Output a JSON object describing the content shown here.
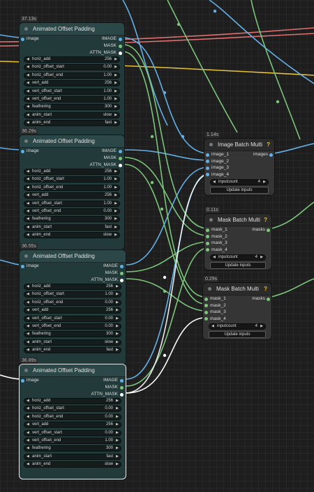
{
  "colors": {
    "canvas": "#1e1e1e",
    "wire_image": "#63b0e6",
    "wire_mask": "#7bc67b",
    "wire_attn_mask": "#ffffff",
    "wire_red": "#e07070",
    "wire_yellow": "#e8c23a",
    "node_body": "#233a3a",
    "help_icon": "#f2c300"
  },
  "offset_nodes": [
    {
      "time": "37.13s",
      "title": "Animated Offset Padding",
      "selected": false,
      "input": "image",
      "outputs": [
        "IMAGE",
        "MASK",
        "ATTN_MASK"
      ],
      "widgets": [
        {
          "label": "horiz_add",
          "value": "256",
          "kind": "number"
        },
        {
          "label": "horiz_offset_start",
          "value": "0.00",
          "kind": "number"
        },
        {
          "label": "horiz_offset_end",
          "value": "1.00",
          "kind": "number"
        },
        {
          "label": "vert_add",
          "value": "256",
          "kind": "number"
        },
        {
          "label": "vert_offset_start",
          "value": "1.00",
          "kind": "number"
        },
        {
          "label": "vert_offset_end",
          "value": "1.00",
          "kind": "number"
        },
        {
          "label": "feathering",
          "value": "300",
          "kind": "number"
        },
        {
          "label": "anim_start",
          "value": "slow",
          "kind": "combo"
        },
        {
          "label": "anim_end",
          "value": "fast",
          "kind": "combo"
        }
      ]
    },
    {
      "time": "36.29s",
      "title": "Animated Offset Padding",
      "selected": false,
      "input": "image",
      "outputs": [
        "IMAGE",
        "MASK",
        "ATTN_MASK"
      ],
      "widgets": [
        {
          "label": "horiz_add",
          "value": "256",
          "kind": "number"
        },
        {
          "label": "horiz_offset_start",
          "value": "1.00",
          "kind": "number"
        },
        {
          "label": "horiz_offset_end",
          "value": "1.00",
          "kind": "number"
        },
        {
          "label": "vert_add",
          "value": "256",
          "kind": "number"
        },
        {
          "label": "vert_offset_start",
          "value": "1.00",
          "kind": "number"
        },
        {
          "label": "vert_offset_end",
          "value": "0.00",
          "kind": "number"
        },
        {
          "label": "feathering",
          "value": "300",
          "kind": "number"
        },
        {
          "label": "anim_start",
          "value": "fast",
          "kind": "combo"
        },
        {
          "label": "anim_end",
          "value": "slow",
          "kind": "combo"
        }
      ]
    },
    {
      "time": "36.55s",
      "title": "Animated Offset Padding",
      "selected": false,
      "input": "image",
      "outputs": [
        "IMAGE",
        "MASK",
        "ATTN_MASK"
      ],
      "widgets": [
        {
          "label": "horiz_add",
          "value": "256",
          "kind": "number"
        },
        {
          "label": "horiz_offset_start",
          "value": "1.00",
          "kind": "number"
        },
        {
          "label": "horiz_offset_end",
          "value": "0.00",
          "kind": "number"
        },
        {
          "label": "vert_add",
          "value": "256",
          "kind": "number"
        },
        {
          "label": "vert_offset_start",
          "value": "0.00",
          "kind": "number"
        },
        {
          "label": "vert_offset_end",
          "value": "0.00",
          "kind": "number"
        },
        {
          "label": "feathering",
          "value": "300",
          "kind": "number"
        },
        {
          "label": "anim_start",
          "value": "slow",
          "kind": "combo"
        },
        {
          "label": "anim_end",
          "value": "fast",
          "kind": "combo"
        }
      ]
    },
    {
      "time": "36.89s",
      "title": "Animated Offset Padding",
      "selected": true,
      "input": "image",
      "outputs": [
        "IMAGE",
        "MASK",
        "ATTN_MASK"
      ],
      "widgets": [
        {
          "label": "horiz_add",
          "value": "256",
          "kind": "number"
        },
        {
          "label": "horiz_offset_start",
          "value": "0.00",
          "kind": "number"
        },
        {
          "label": "horiz_offset_end",
          "value": "0.00",
          "kind": "number"
        },
        {
          "label": "vert_add",
          "value": "256",
          "kind": "number"
        },
        {
          "label": "vert_offset_start",
          "value": "0.00",
          "kind": "number"
        },
        {
          "label": "vert_offset_end",
          "value": "1.00",
          "kind": "number"
        },
        {
          "label": "feathering",
          "value": "300",
          "kind": "number"
        },
        {
          "label": "anim_start",
          "value": "fast",
          "kind": "combo"
        },
        {
          "label": "anim_end",
          "value": "slow",
          "kind": "combo"
        }
      ]
    }
  ],
  "batch_nodes": [
    {
      "time": "1.14s",
      "title": "Image Batch Multi",
      "help": "?",
      "inputs": [
        "image_1",
        "image_2",
        "image_3",
        "image_4"
      ],
      "output": "images",
      "inputcount_label": "inputcount",
      "inputcount_value": "4",
      "button": "Update inputs"
    },
    {
      "time": "0.11s",
      "title": "Mask Batch Multi",
      "help": "?",
      "inputs": [
        "mask_1",
        "mask_2",
        "mask_3",
        "mask_4"
      ],
      "output": "masks",
      "inputcount_label": "inputcount",
      "inputcount_value": "4",
      "button": "Update inputs"
    },
    {
      "time": "0.29s",
      "title": "Mask Batch Multi",
      "help": "?",
      "inputs": [
        "mask_1",
        "mask_2",
        "mask_3",
        "mask_4"
      ],
      "output": "masks",
      "inputcount_label": "inputcount",
      "inputcount_value": "4",
      "button": "Update inputs"
    }
  ]
}
